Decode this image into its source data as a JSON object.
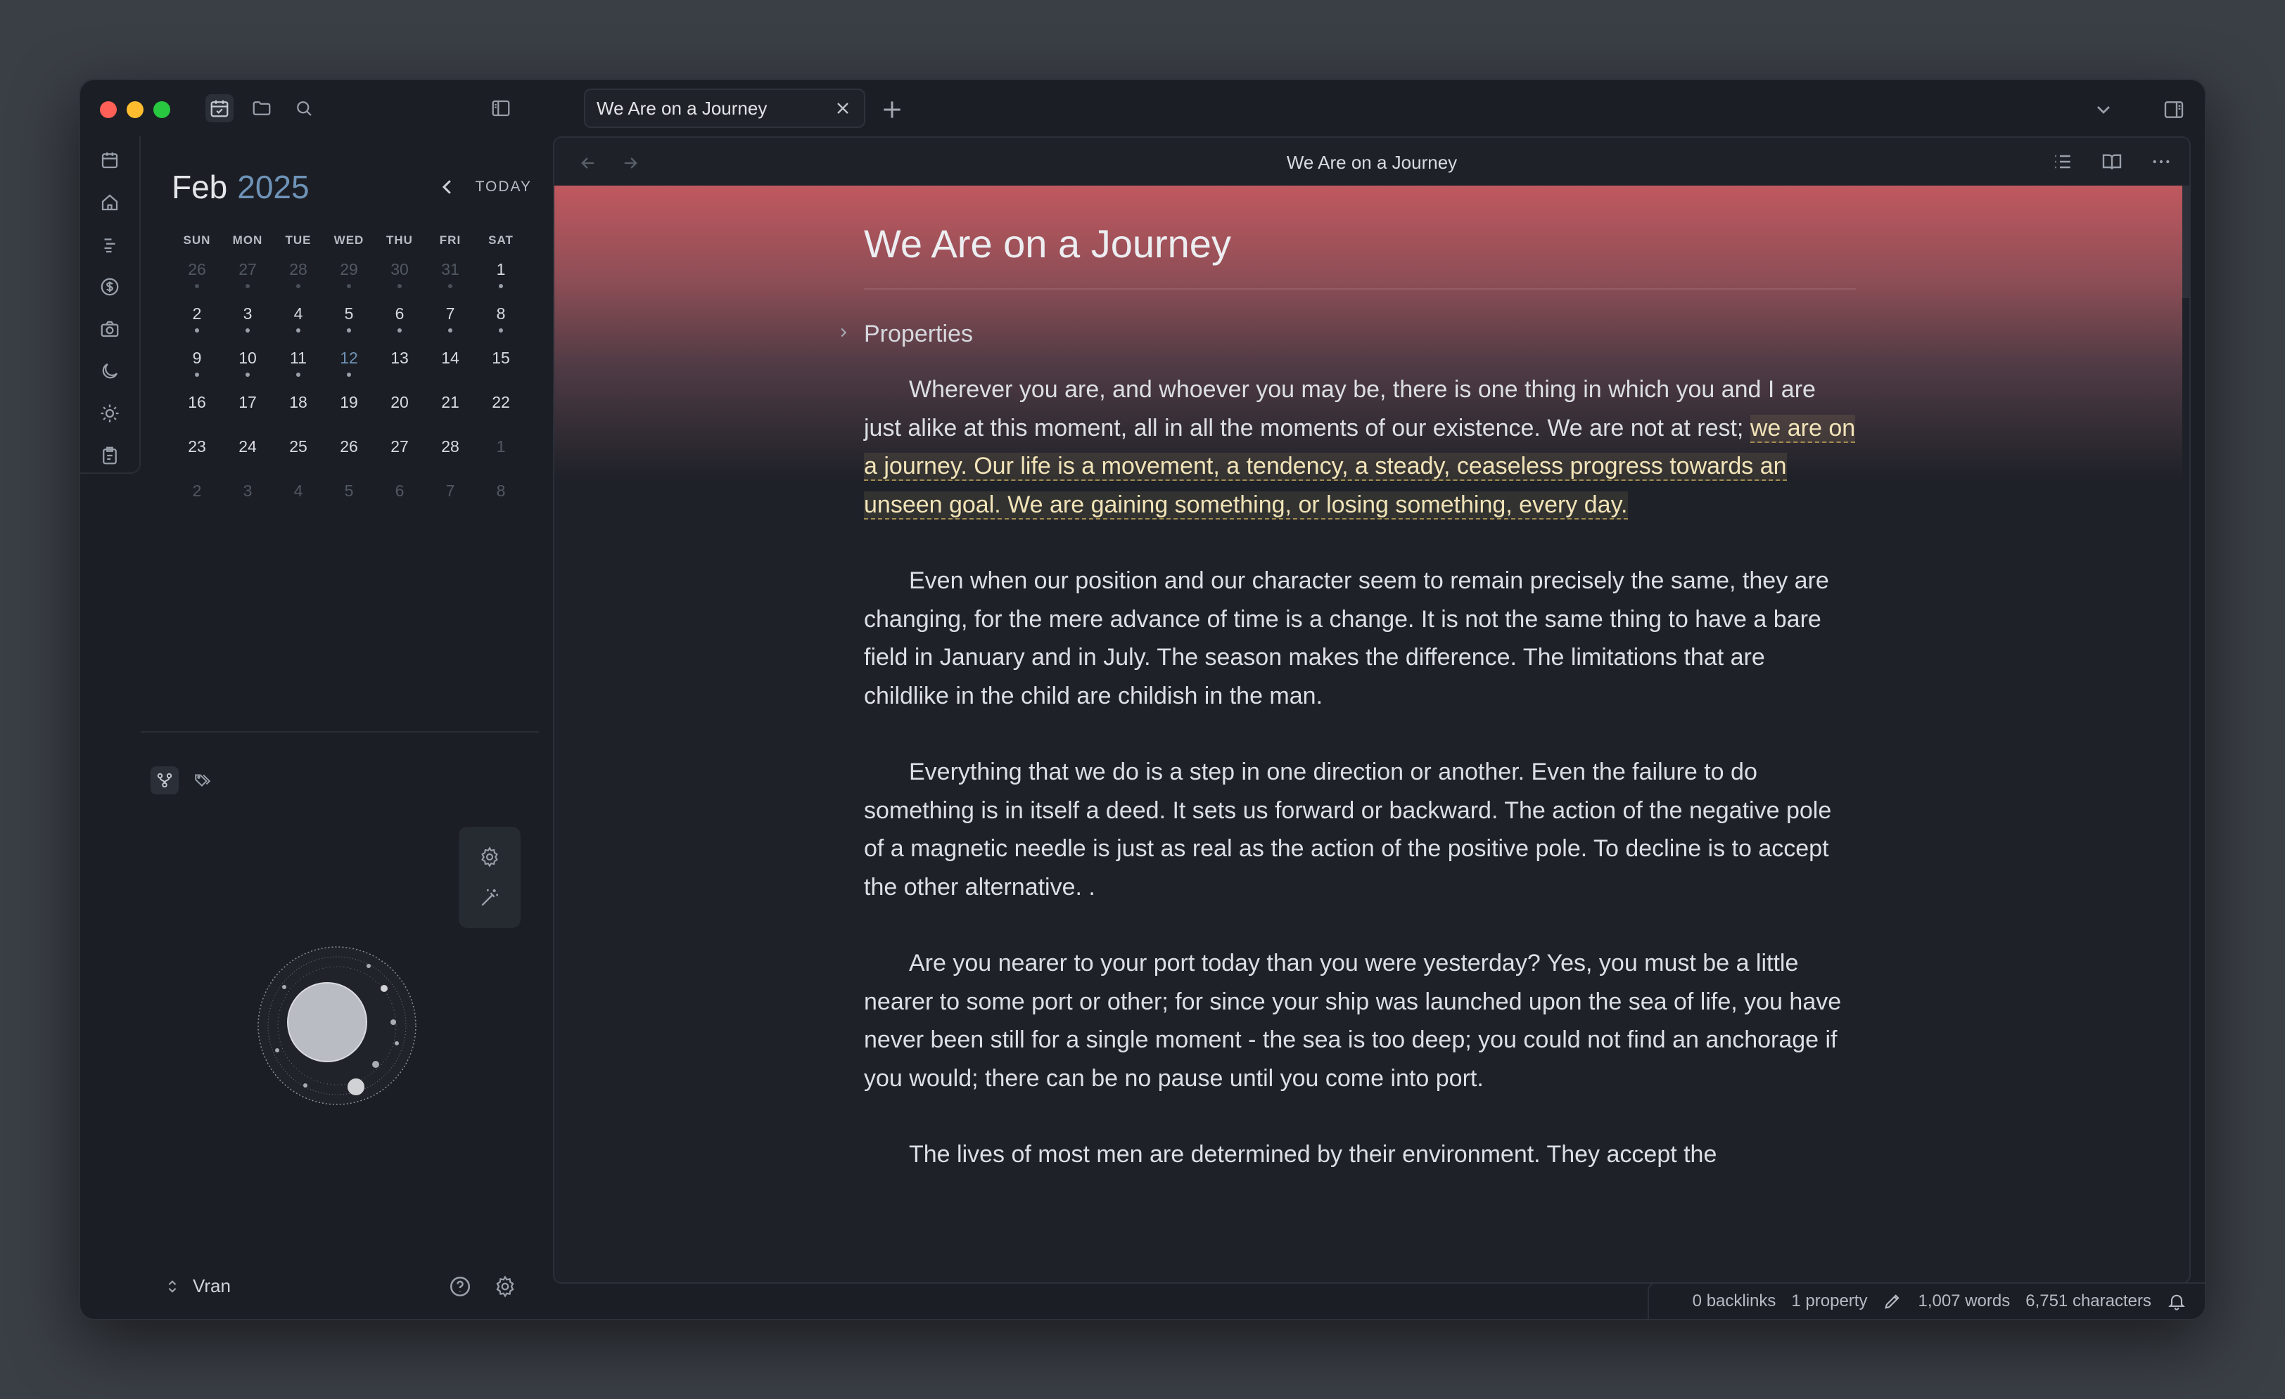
{
  "app": {
    "accent_color": "#6f93b8",
    "highlight_color": "#f2e4b8",
    "banner_color": "#c0585f"
  },
  "tab": {
    "label": "We Are on a Journey"
  },
  "view": {
    "title": "We Are on a Journey"
  },
  "calendar": {
    "month": "Feb",
    "year": "2025",
    "today_label": "TODAY",
    "weekdays": [
      "SUN",
      "MON",
      "TUE",
      "WED",
      "THU",
      "FRI",
      "SAT"
    ],
    "days": [
      {
        "d": "26",
        "muted": true,
        "dot": true
      },
      {
        "d": "27",
        "muted": true,
        "dot": true
      },
      {
        "d": "28",
        "muted": true,
        "dot": true
      },
      {
        "d": "29",
        "muted": true,
        "dot": true
      },
      {
        "d": "30",
        "muted": true,
        "dot": true
      },
      {
        "d": "31",
        "muted": true,
        "dot": true
      },
      {
        "d": "1",
        "dot": true
      },
      {
        "d": "2",
        "dot": true
      },
      {
        "d": "3",
        "dot": true
      },
      {
        "d": "4",
        "dot": true
      },
      {
        "d": "5",
        "dot": true
      },
      {
        "d": "6",
        "dot": true
      },
      {
        "d": "7",
        "dot": true
      },
      {
        "d": "8",
        "dot": true
      },
      {
        "d": "9",
        "dot": true
      },
      {
        "d": "10",
        "dot": true
      },
      {
        "d": "11",
        "dot": true
      },
      {
        "d": "12",
        "today": true,
        "dot": true
      },
      {
        "d": "13"
      },
      {
        "d": "14"
      },
      {
        "d": "15"
      },
      {
        "d": "16"
      },
      {
        "d": "17"
      },
      {
        "d": "18"
      },
      {
        "d": "19"
      },
      {
        "d": "20"
      },
      {
        "d": "21"
      },
      {
        "d": "22"
      },
      {
        "d": "23"
      },
      {
        "d": "24"
      },
      {
        "d": "25"
      },
      {
        "d": "26"
      },
      {
        "d": "27"
      },
      {
        "d": "28"
      },
      {
        "d": "1",
        "muted": true
      },
      {
        "d": "2",
        "muted": true
      },
      {
        "d": "3",
        "muted": true
      },
      {
        "d": "4",
        "muted": true
      },
      {
        "d": "5",
        "muted": true
      },
      {
        "d": "6",
        "muted": true
      },
      {
        "d": "7",
        "muted": true
      },
      {
        "d": "8",
        "muted": true
      }
    ]
  },
  "vault": {
    "name": "Vran"
  },
  "document": {
    "title": "We Are on a Journey",
    "properties_label": "Properties",
    "p1_lead": "Wherever you are, and whoever you may be, there is one thing in which you and I are just alike at this moment, all in all the moments of our existence. We are not at rest; ",
    "p1_highlight": " we are on a journey. Our life is a movement, a tendency, a steady, ceaseless progress towards an unseen goal. We are gaining something, or losing something, every day.  ",
    "p2": "Even when our position and our character seem to remain precisely the same, they are changing, for the mere advance of time is a change. It is not the same thing to have a bare field in January and in July. The season makes the difference. The limitations that are childlike in the child are childish in the man.",
    "p3": "Everything that we do is a step in one direction or another. Even the failure to do something is in itself a deed. It sets us forward or backward. The action of the negative pole of a magnetic needle is just as real as the action of the positive pole. To decline is to accept the other alternative. .",
    "p4": "Are you nearer to your port today than you were yesterday? Yes, you must be a little nearer to some port or other; for since your ship was launched upon the sea of life, you have never been still for a single moment - the sea is too deep; you could not find an anchorage if you would; there can be no pause until you come into port.",
    "p5": "The lives of most men are determined by their environment. They accept the"
  },
  "status": {
    "backlinks": "0 backlinks",
    "properties": "1 property",
    "words": "1,007 words",
    "characters": "6,751 characters"
  }
}
